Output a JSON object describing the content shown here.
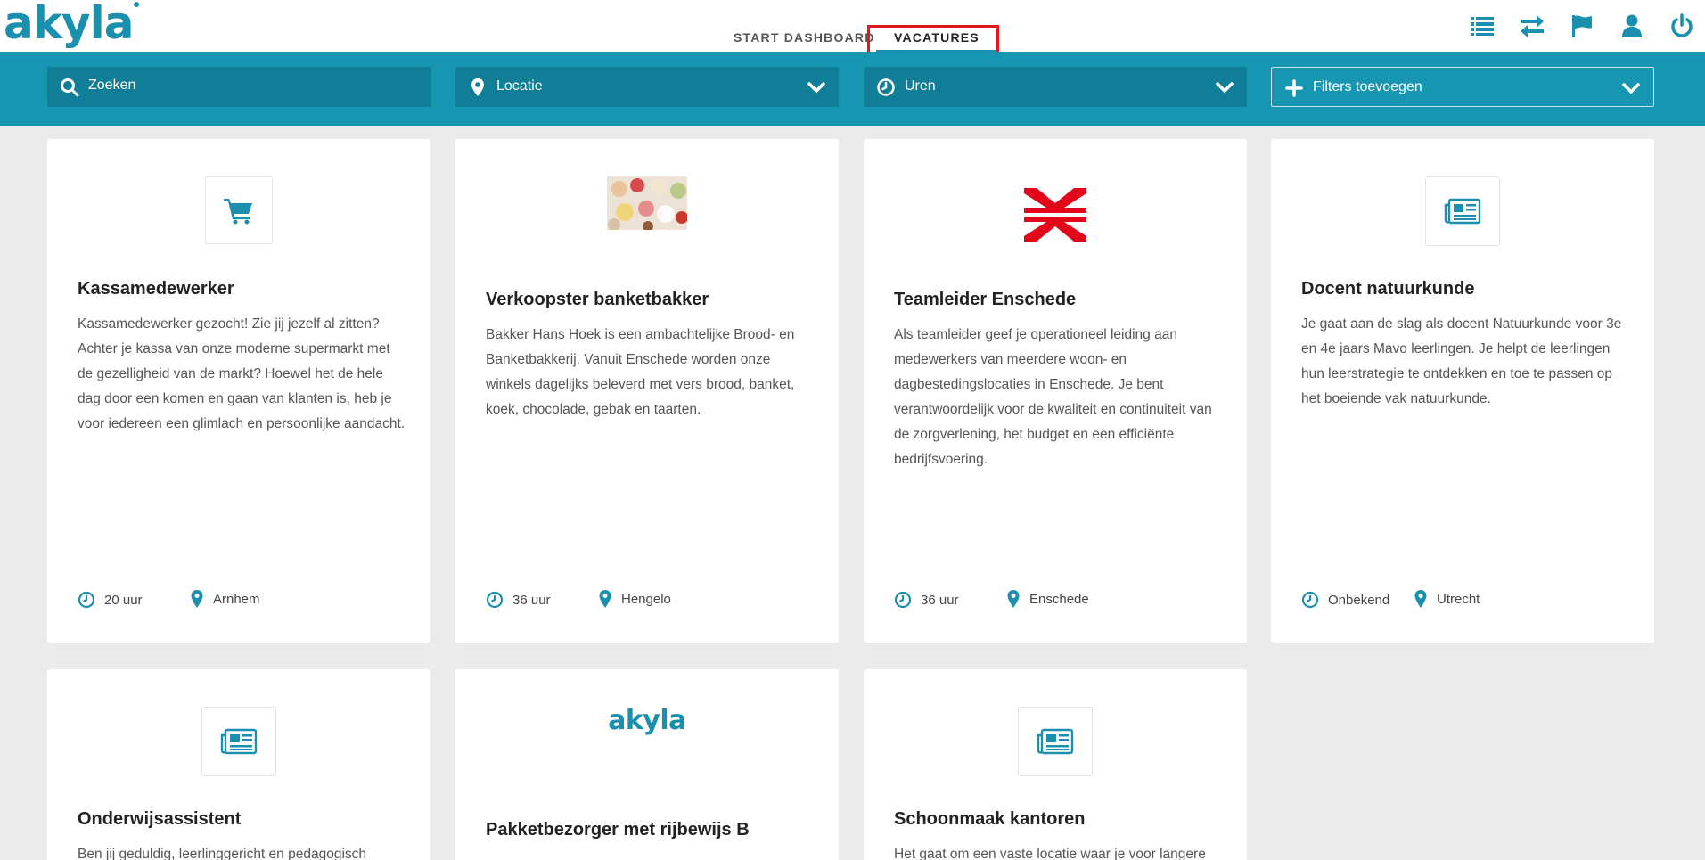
{
  "header": {
    "logo_text": "akyla",
    "tabs": [
      {
        "label": "START DASHBOARD",
        "active": false
      },
      {
        "label": "VACATURES",
        "active": true
      }
    ],
    "icons": [
      "list-icon",
      "transfer-icon",
      "flag-icon",
      "user-icon",
      "power-icon"
    ]
  },
  "filters": {
    "search_placeholder": "Zoeken",
    "location_label": "Locatie",
    "hours_label": "Uren",
    "add_filters_label": "Filters toevoegen"
  },
  "cards": [
    {
      "title": "Kassamedewerker",
      "description": "Kassamedewerker gezocht! Zie jij jezelf al zitten? Achter je kassa van onze moderne supermarkt met de gezelligheid van de markt? Hoewel het de hele dag door een komen en gaan van klanten is, heb je voor iedereen een glimlach en persoonlijke aandacht.",
      "hours": "20 uur",
      "location": "Arnhem",
      "logo": "cart-icon"
    },
    {
      "title": "Verkoopster banketbakker",
      "description": "Bakker Hans Hoek is een ambachtelijke Brood- en Banketbakkerij. Vanuit Enschede worden onze winkels dagelijks beleverd met vers brood, banket, koek, chocolade, gebak en taarten.",
      "hours": "36 uur",
      "location": "Hengelo",
      "logo": "bakery-photo"
    },
    {
      "title": "Teamleider Enschede",
      "description": "Als teamleider geef je operationeel leiding aan medewerkers van meerdere woon- en dagbestedingslocaties in Enschede. Je bent verantwoordelijk voor de kwaliteit en continuiteit van de zorgverlening, het budget en een efficiënte bedrijfsvoering.",
      "hours": "36 uur",
      "location": "Enschede",
      "logo": "ns-logo"
    },
    {
      "title": "Docent natuurkunde",
      "description": "Je gaat aan de slag als docent Natuurkunde voor 3e en 4e jaars Mavo leerlingen. Je helpt de leerlingen hun leerstrategie te ontdekken en toe te passen op het boeiende vak natuurkunde.",
      "hours": "Onbekend",
      "location": "Utrecht",
      "logo": "newspaper-icon"
    },
    {
      "title": "Onderwijsassistent",
      "description": "Ben jij geduldig, leerlinggericht en pedagogisch",
      "logo": "newspaper-icon"
    },
    {
      "title": "Pakketbezorger met rijbewijs B",
      "description": "",
      "logo": "akyla",
      "logo_text": "akyla"
    },
    {
      "title": "Schoonmaak kantoren",
      "description": "Het gaat om een vaste locatie waar je voor langere",
      "logo": "newspaper-icon"
    }
  ],
  "colors": {
    "accent": "#1a8fae",
    "filterbar": "#1796b2",
    "filterbox": "#117e97",
    "highlight": "#e0191f",
    "ns_red": "#e3061a"
  }
}
